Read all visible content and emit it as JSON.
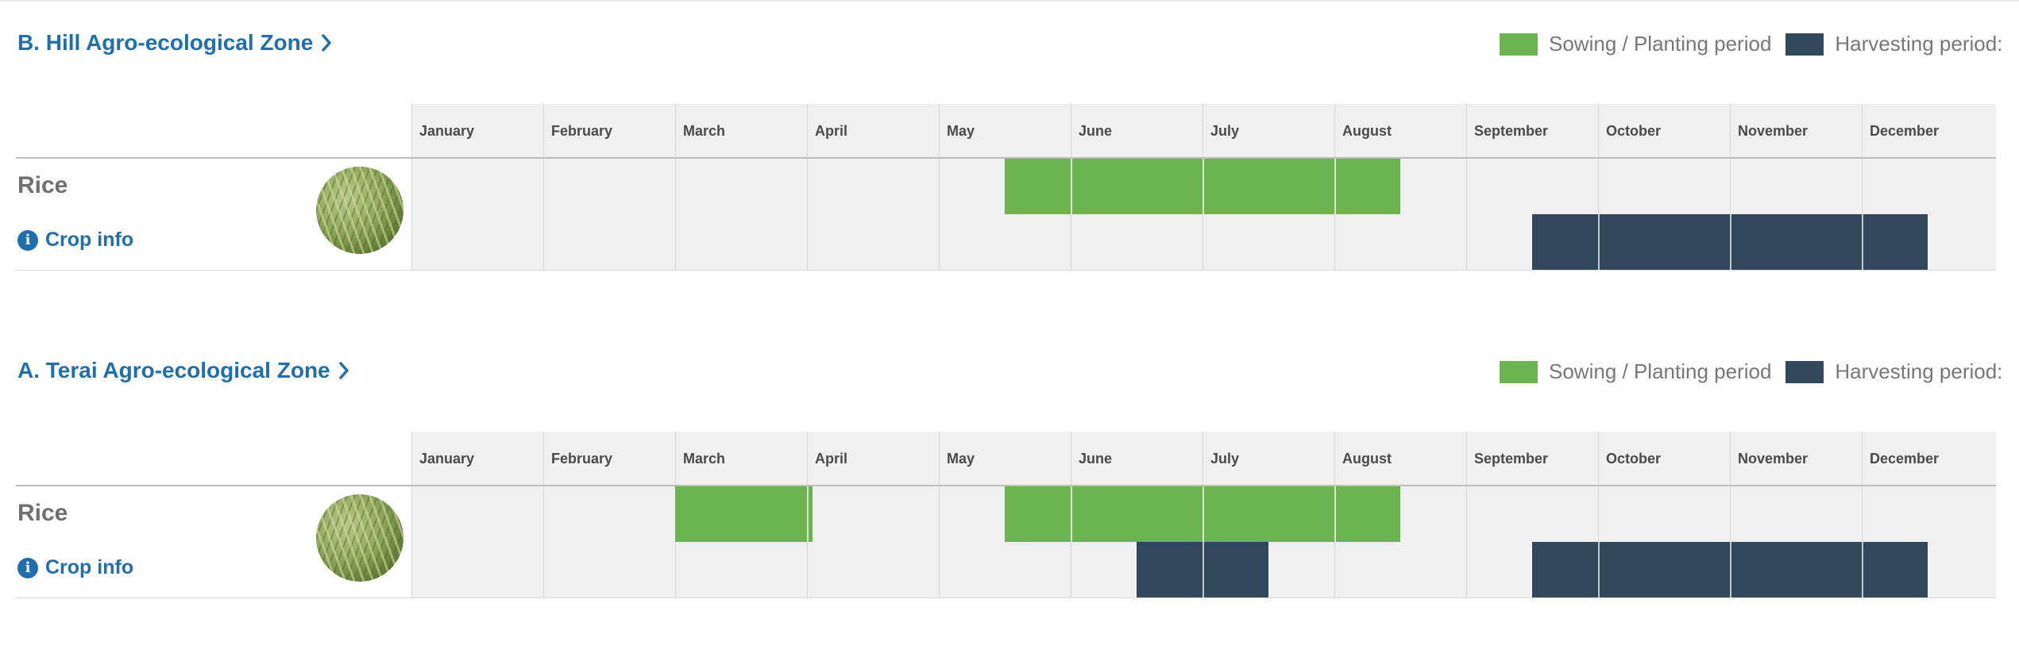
{
  "colors": {
    "sowing": "#6ab550",
    "harvesting": "#31475c",
    "link": "#1f6fae"
  },
  "legend": {
    "sowing_label": "Sowing / Planting period",
    "harvesting_label": "Harvesting period:"
  },
  "months": [
    "January",
    "February",
    "March",
    "April",
    "May",
    "June",
    "July",
    "August",
    "September",
    "October",
    "November",
    "December"
  ],
  "zones": [
    {
      "title": "B. Hill Agro-ecological Zone",
      "crop": {
        "name": "Rice",
        "info_label": "Crop info",
        "icon": "info-icon",
        "sowing_periods": [
          {
            "start": "May 15",
            "end": "Aug 15"
          }
        ],
        "harvesting_periods": [
          {
            "start": "Sep 15",
            "end": "Dec 15"
          }
        ]
      }
    },
    {
      "title": "A. Terai Agro-ecological Zone",
      "crop": {
        "name": "Rice",
        "info_label": "Crop info",
        "icon": "info-icon",
        "sowing_periods": [
          {
            "start": "Mar 1",
            "end": "Apr 1"
          },
          {
            "start": "May 15",
            "end": "Aug 15"
          }
        ],
        "harvesting_periods": [
          {
            "start": "Jun 15",
            "end": "Jul 15"
          },
          {
            "start": "Sep 15",
            "end": "Dec 15"
          }
        ]
      }
    }
  ]
}
